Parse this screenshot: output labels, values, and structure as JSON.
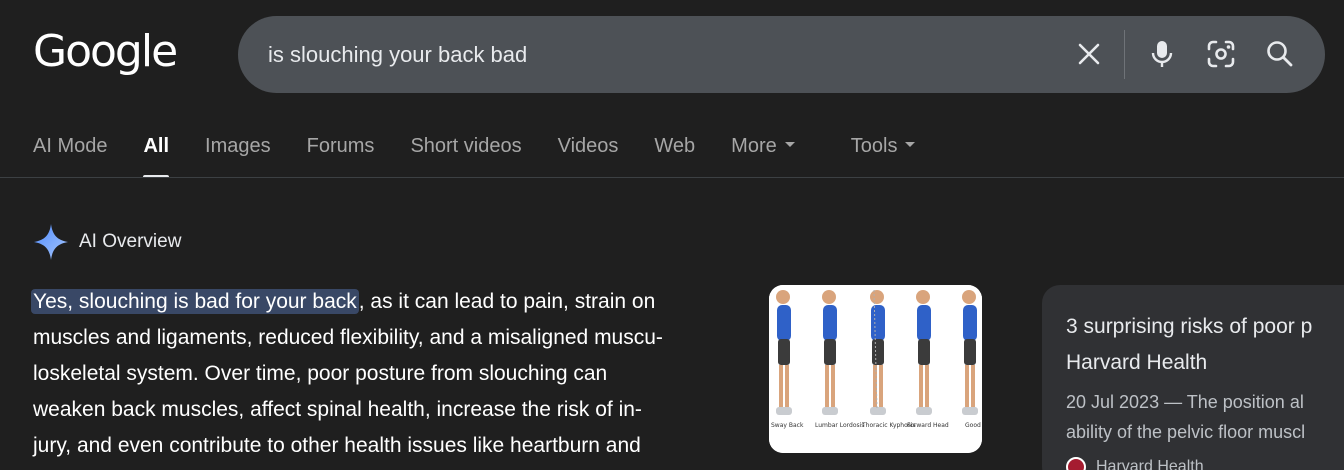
{
  "logo": {
    "text": "Google"
  },
  "search": {
    "value": "is slouching your back bad"
  },
  "tabs": [
    {
      "label": "AI Mode",
      "active": false
    },
    {
      "label": "All",
      "active": true
    },
    {
      "label": "Images",
      "active": false
    },
    {
      "label": "Forums",
      "active": false
    },
    {
      "label": "Short videos",
      "active": false
    },
    {
      "label": "Videos",
      "active": false
    },
    {
      "label": "Web",
      "active": false
    },
    {
      "label": "More",
      "active": false
    },
    {
      "label": "Tools",
      "active": false
    }
  ],
  "ai_overview": {
    "title": "AI Overview",
    "highlight": "Yes, slouching is bad for your back",
    "lines": [
      ", as it can lead to pain, strain on",
      "muscles and ligaments, reduced flexibility, and a misaligned muscu-",
      "loskeletal system. Over time, poor posture from slouching can",
      "weaken back muscles, affect spinal health, increase the risk of in-",
      "jury, and even contribute to other health issues like heartburn and"
    ],
    "image_captions": [
      "Sway Back",
      "Lumbar Lordosis",
      "Thoracic Kyphosis",
      "Forward Head",
      "Good"
    ]
  },
  "source_card": {
    "title_line1": "3 surprising risks of poor p",
    "title_line2": "Harvard Health",
    "snippet_line1": "20 Jul 2023 — The position al",
    "snippet_line2": "ability of the pelvic floor muscl",
    "source_name": "Harvard Health"
  },
  "colors": {
    "background": "#1f1f1f",
    "searchbar": "#4d5156",
    "highlight": "#394866",
    "card": "#303134",
    "sparkle": "#7ba7ff"
  },
  "icons": [
    "clear-icon",
    "mic-icon",
    "lens-icon",
    "search-icon",
    "sparkle-icon"
  ]
}
